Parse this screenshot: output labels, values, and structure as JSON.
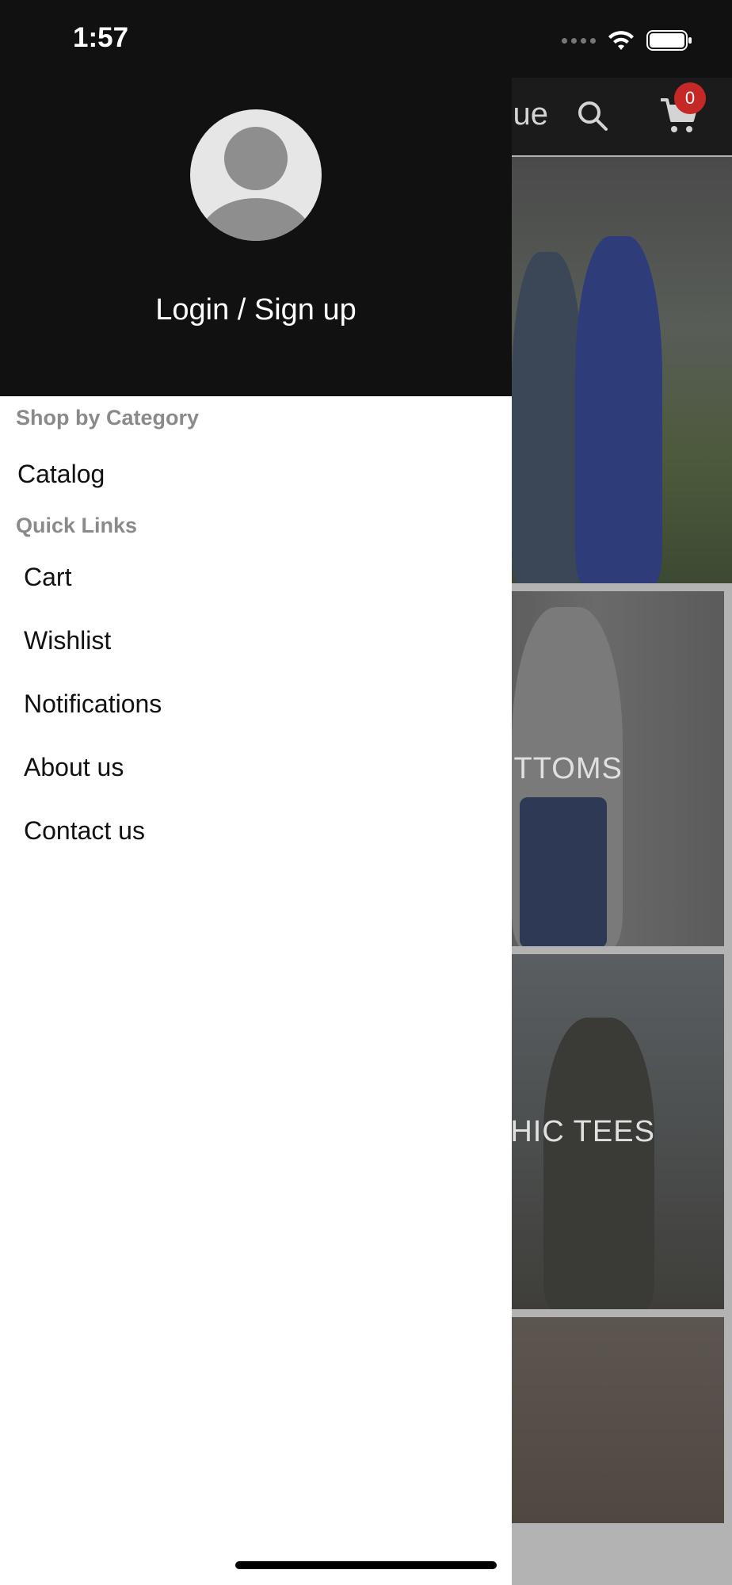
{
  "status_bar": {
    "time": "1:57"
  },
  "app_header": {
    "title_fragment": "ue",
    "cart_count": "0",
    "icons": [
      "search-icon",
      "cart-icon"
    ]
  },
  "background_panels": [
    {
      "label": ""
    },
    {
      "label": "OTTOMS"
    },
    {
      "label": "PHIC TEES"
    },
    {
      "label": ""
    }
  ],
  "drawer": {
    "login_label": "Login / Sign up",
    "shop_by_category": {
      "heading": "Shop by Category",
      "items": [
        {
          "label": "Catalog"
        }
      ]
    },
    "quick_links": {
      "heading": "Quick Links",
      "items": [
        {
          "label": "Cart"
        },
        {
          "label": "Wishlist"
        },
        {
          "label": "Notifications"
        },
        {
          "label": "About us"
        },
        {
          "label": "Contact us"
        }
      ]
    }
  },
  "colors": {
    "drawer_header": "#111111",
    "badge": "#c62828",
    "section_heading": "#8a8a8a"
  }
}
